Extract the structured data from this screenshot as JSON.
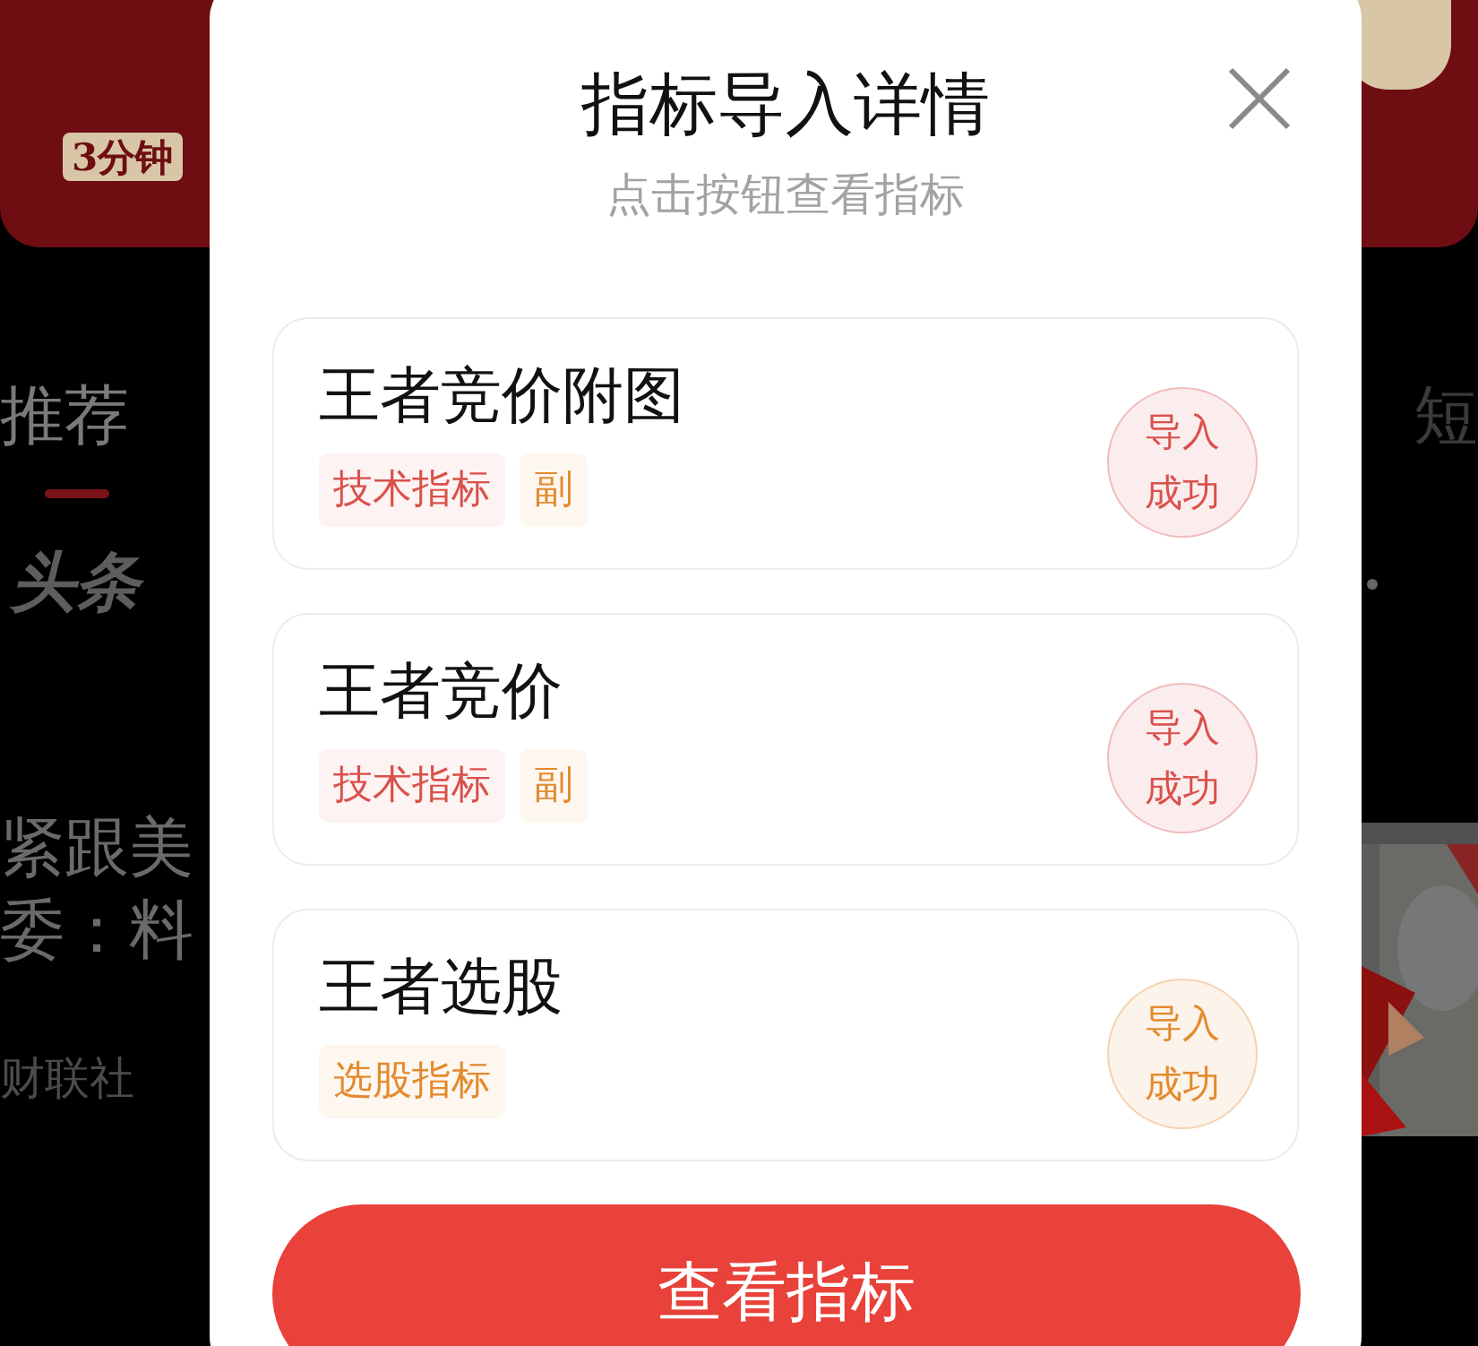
{
  "background": {
    "banner": {
      "tag": "3分钟"
    },
    "tabs": [
      {
        "label": "推荐",
        "selected": true
      },
      {
        "label": "短",
        "selected": false
      }
    ],
    "logo": "头条",
    "headline": [
      "紧跟美",
      "委：料"
    ],
    "source": "财联社",
    "photo": {
      "kind": "picture"
    }
  },
  "dialog": {
    "title": "指标导入详情",
    "subtitle": "点击按钮查看指标",
    "items": [
      {
        "name": "王者竞价附图",
        "tags": [
          {
            "text": "技术指标",
            "color": "#d9514c"
          },
          {
            "text": "副",
            "color": "#e38a2e"
          }
        ],
        "status": {
          "text": "导入成功",
          "color": "#d9514c"
        }
      },
      {
        "name": "王者竞价",
        "tags": [
          {
            "text": "技术指标",
            "color": "#d9514c"
          },
          {
            "text": "副",
            "color": "#e38a2e"
          }
        ],
        "status": {
          "text": "导入成功",
          "color": "#d9514c"
        }
      },
      {
        "name": "王者选股",
        "tags": [
          {
            "text": "选股指标",
            "color": "#e38a2e"
          }
        ],
        "status": {
          "text": "导入成功",
          "color": "#e38a2e"
        }
      }
    ],
    "button": "查看指标"
  }
}
